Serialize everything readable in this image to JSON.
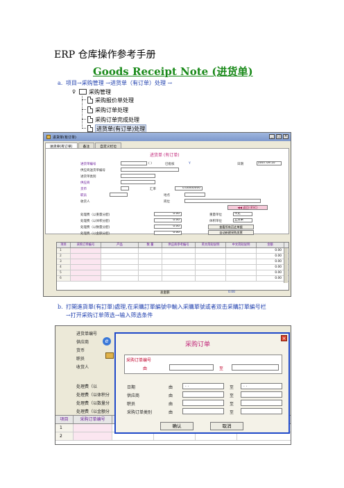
{
  "doc": {
    "title": "ERP  仓库操作参考手册",
    "section_title": "Goods Receipt Note (进货单)"
  },
  "steps": {
    "a_marker": "a.",
    "a_text": "项目→采购管理 →进货单（有订单）处理 →",
    "b_marker": "b.",
    "b_line1": "打開進貨單(有訂單)處理,在采購訂單編號中輸入采購單號或者双击采購訂單編号栏",
    "b_line2": "→打开采购订单筛选→输入筛选条件"
  },
  "tree": {
    "root": "采购管理",
    "items": [
      "采购报价单处理",
      "采购订单处理",
      "采购订单完成处理",
      "进货单(有订单)处理"
    ]
  },
  "window1": {
    "title": "进货单(有订单)",
    "tabs": [
      "进货单(有订单)",
      "备注",
      "自定义栏位"
    ],
    "heading": "进货单 (有订单)",
    "labels": {
      "doc_no": "进货单编号",
      "supplier_delivery_no": "供应商送货单编号",
      "receipt_category": "进货单类别",
      "supplier": "供应商",
      "currency": "货币",
      "staff": "职员",
      "receiver": "收货人",
      "open_brackets": "(          )",
      "posted": "已批核",
      "posted_val": "Y",
      "date": "日期",
      "date_val": "2007.09.10",
      "exchange_rate": "汇率",
      "exchange_rate_val": "0.00000000",
      "location": "地点",
      "position": "岗位",
      "fee_weight": "处理费（以重量分配)",
      "fee_volume": "处理费（以体积分配)",
      "fee_qty": "处理费（以数量分配)",
      "fee_amount": "处理费（以金额分配)",
      "fee_weight_val": "0.00",
      "fee_volume_val": "0.00",
      "fee_qty_val": "0.00",
      "fee_amount_val": "0.00",
      "weight_unit": "重量单位",
      "weight_unit_val": "千克",
      "volume_unit": "体积单位",
      "volume_unit_val": "立方米",
      "back_btn": "◀◀ 返回 (ESC)",
      "view_history_btn": "查看所有历史单据",
      "auto_create_btn": "自动新建采购发票"
    },
    "grid": {
      "headers": [
        "项目",
        "采购订单编号",
        "产品",
        "数 量",
        "供应商参考编号",
        "英文简短说明",
        "中文简短说明",
        "金额"
      ],
      "rows": [
        {
          "n": "1",
          "amt": "0.00"
        },
        {
          "n": "2",
          "amt": "0.00"
        },
        {
          "n": "3",
          "amt": "0.00"
        },
        {
          "n": "4",
          "amt": "0.00"
        },
        {
          "n": "5",
          "amt": "0.00"
        },
        {
          "n": "6",
          "amt": "0.00"
        }
      ],
      "total_label": "总金额",
      "total_val": "0.00"
    }
  },
  "shot2": {
    "bg_labels": [
      "进货单编号",
      "供应商",
      "货币",
      "职员",
      "收货人",
      "处理费（以",
      "处理费（以体积分",
      "处理费（以数量分",
      "处理费（以金额分"
    ],
    "grid_headers": [
      "项目",
      "采购订单编号"
    ],
    "rows": [
      "1",
      "2"
    ]
  },
  "dialog": {
    "title": "采购订单",
    "po_no_label": "采购订单编号",
    "from": "由",
    "to": "至",
    "date": "日期",
    "supplier": "供应商",
    "staff": "职员",
    "po_type": "采购订单类别",
    "date_placeholder": ". .",
    "ok": "确认",
    "cancel": "取消"
  }
}
